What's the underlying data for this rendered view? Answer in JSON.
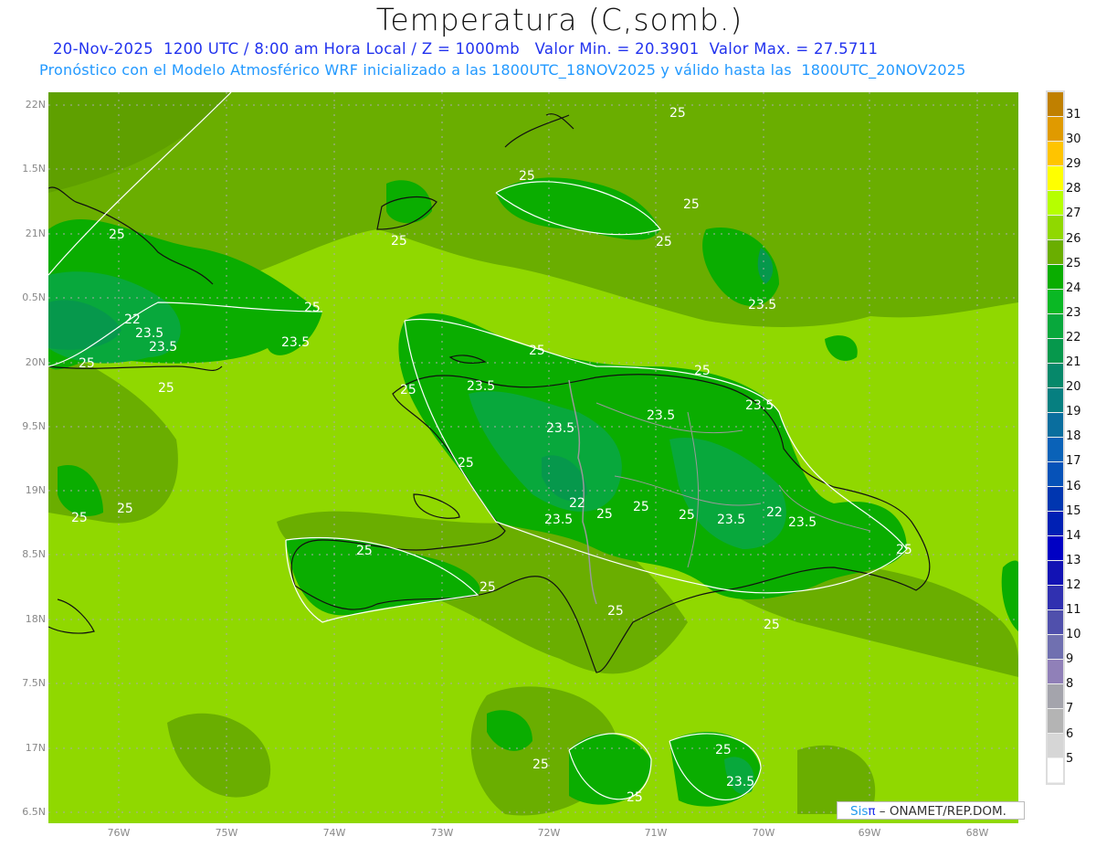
{
  "header": {
    "title": "Temperatura (C,somb.)",
    "subtitle_line1": "20-Nov-2025  1200 UTC / 8:00 am Hora Local / Z = 1000mb   Valor Min. = 20.3901  Valor Max. = 27.5711",
    "subtitle_line2": "Pronóstico con el Modelo Atmosférico WRF inicializado a las 1800UTC_18NOV2025 y válido hasta las  1800UTC_20NOV2025"
  },
  "map": {
    "lat_labels": [
      "22N",
      "1.5N",
      "21N",
      "0.5N",
      "20N",
      "9.5N",
      "19N",
      "8.5N",
      "18N",
      "7.5N",
      "17N",
      "6.5N"
    ],
    "lon_labels": [
      "76W",
      "75W",
      "74W",
      "73W",
      "72W",
      "71W",
      "70W",
      "69W",
      "68W"
    ],
    "contour_labels": [
      "25",
      "23.5",
      "22"
    ]
  },
  "colorbar": {
    "labels": [
      "31",
      "30",
      "29",
      "28",
      "27",
      "26",
      "25",
      "24",
      "23",
      "22",
      "21",
      "20",
      "19",
      "18",
      "17",
      "16",
      "15",
      "14",
      "13",
      "12",
      "11",
      "10",
      "9",
      "8",
      "7",
      "6",
      "5"
    ],
    "colors": [
      "#c08000",
      "#e09a00",
      "#ffc400",
      "#ffff00",
      "#b6ff00",
      "#90d800",
      "#6aae00",
      "#0aad00",
      "#0ab824",
      "#08a83c",
      "#06984c",
      "#06886a",
      "#067f80",
      "#0a6e9e",
      "#0a62b8",
      "#0652b8",
      "#0036b0",
      "#0020b4",
      "#0000c4",
      "#1212b4",
      "#3030b0",
      "#5050ac",
      "#7070b0",
      "#9080b8",
      "#a4a4ac",
      "#b4b4b4",
      "#d6d6d6",
      "#ffffff"
    ]
  },
  "credit": {
    "brand_a": "Sis",
    "brand_b": "π",
    "text": " –  ONAMET/REP.DOM."
  }
}
